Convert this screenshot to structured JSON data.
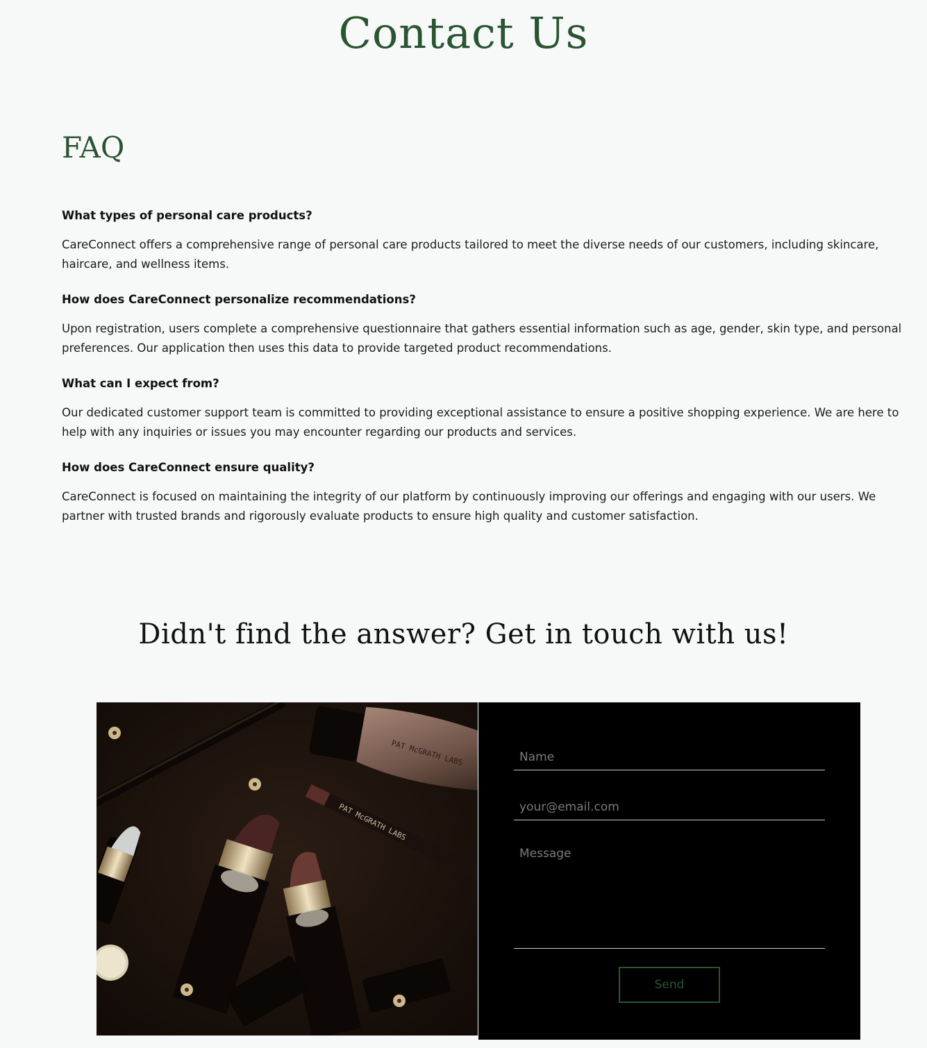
{
  "page": {
    "title": "Contact Us"
  },
  "faq": {
    "heading": "FAQ",
    "items": [
      {
        "question": "What types of personal care products?",
        "answer": "CareConnect offers a comprehensive range of personal care products tailored to meet the diverse needs of our customers, including skincare, haircare, and wellness items."
      },
      {
        "question": "How does CareConnect personalize recommendations?",
        "answer": "Upon registration, users complete a comprehensive questionnaire that gathers essential information such as age, gender, skin type, and personal preferences. Our application then uses this data to provide targeted product recommendations."
      },
      {
        "question": "What can I expect from?",
        "answer": "Our dedicated customer support team is committed to providing exceptional assistance to ensure a positive shopping experience. We are here to help with any inquiries or issues you may encounter regarding our products and services."
      },
      {
        "question": "How does CareConnect ensure quality?",
        "answer": "CareConnect is focused on maintaining the integrity of our platform by continuously improving our offerings and engaging with our users. We partner with trusted brands and rigorously evaluate products to ensure high quality and customer satisfaction."
      }
    ]
  },
  "contact": {
    "heading": "Didn't find the answer? Get in touch with us!",
    "image": {
      "brand_text_1": "PAT McGRATH LABS",
      "brand_text_2": "PAT McGRATH LABS"
    },
    "form": {
      "name_placeholder": "Name",
      "email_placeholder": "your@email.com",
      "message_placeholder": "Message",
      "send_label": "Send"
    }
  },
  "colors": {
    "accent": "#2b5433",
    "background": "#f7f9f8",
    "form_background": "#000000"
  }
}
